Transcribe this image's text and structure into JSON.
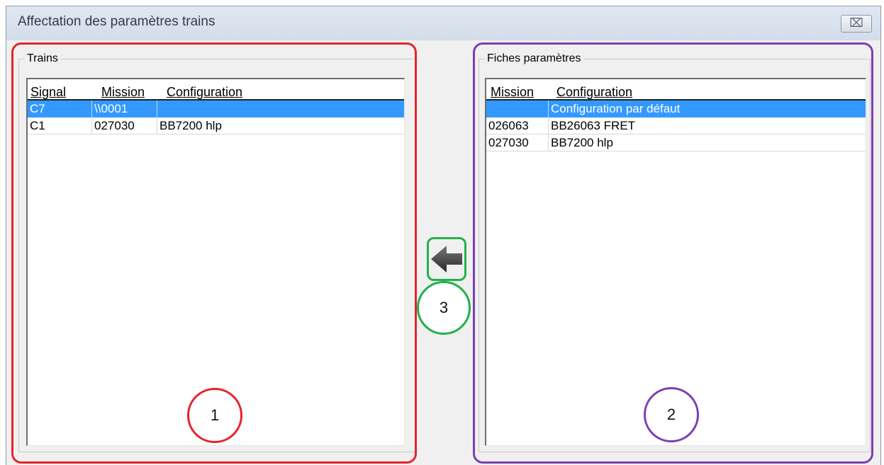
{
  "window": {
    "title": "Affectation des paramètres trains",
    "close_glyph": "⌧"
  },
  "trains_group": {
    "legend": "Trains",
    "columns": [
      "Signal",
      "Mission",
      "Configuration"
    ],
    "rows": [
      {
        "signal": "C7",
        "mission": "\\\\0001",
        "configuration": "",
        "selected": true
      },
      {
        "signal": "C1",
        "mission": "027030",
        "configuration": "BB7200 hlp",
        "selected": false
      }
    ]
  },
  "params_group": {
    "legend": "Fiches paramètres",
    "columns": [
      "Mission",
      "Configuration"
    ],
    "rows": [
      {
        "mission": "",
        "configuration": "Configuration par défaut",
        "selected": true
      },
      {
        "mission": "026063",
        "configuration": "BB26063 FRET",
        "selected": false
      },
      {
        "mission": "027030",
        "configuration": "BB7200 hlp",
        "selected": false
      }
    ]
  },
  "annotations": {
    "label_1": "1",
    "label_2": "2",
    "label_3": "3",
    "color_1": "#e8232a",
    "color_2": "#7a3fb5",
    "color_3": "#22b14c"
  },
  "icons": {
    "assign_button": "arrow-left-icon"
  },
  "colors": {
    "selection": "#3399ff"
  }
}
